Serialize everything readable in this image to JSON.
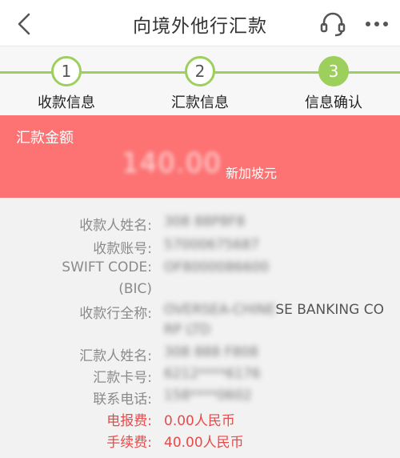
{
  "header": {
    "title": "向境外他行汇款"
  },
  "steps": [
    {
      "number": "1",
      "label": "收款信息",
      "state": "done"
    },
    {
      "number": "2",
      "label": "汇款信息",
      "state": "done"
    },
    {
      "number": "3",
      "label": "信息确认",
      "state": "active"
    }
  ],
  "amount": {
    "title": "汇款金额",
    "value": "140.00",
    "currency": "新加坡元"
  },
  "details": {
    "payee_name_label": "收款人姓名:",
    "payee_name_value": "308 88P8F8",
    "payee_account_label": "收款账号:",
    "payee_account_value": "57000675687",
    "swift_label_line1": "SWIFT CODE:",
    "swift_label_line2": "(BIC)",
    "swift_value": "OF8000086600",
    "bank_label": "收款行全称:",
    "bank_value_blurred": "OVERSEA-CHINE",
    "bank_value_visible": "SE BANKING CO",
    "bank_value_line2": "RP LTD",
    "remitter_name_label": "汇款人姓名:",
    "remitter_name_value": "308 888 F808",
    "card_label": "汇款卡号:",
    "card_value": "6212****6176",
    "phone_label": "联系电话:",
    "phone_value": "158****0602",
    "telegraph_fee_label": "电报费:",
    "telegraph_fee_value": "0.00人民币",
    "handling_fee_label": "手续费:",
    "handling_fee_value": "40.00人民币"
  },
  "colors": {
    "accent_green": "#9ccf5b",
    "banner_red": "#fd7273",
    "fee_red": "#e84a4a"
  },
  "icons": {
    "back": "chevron-left-icon",
    "support": "headset-icon",
    "more": "more-dots-icon"
  }
}
